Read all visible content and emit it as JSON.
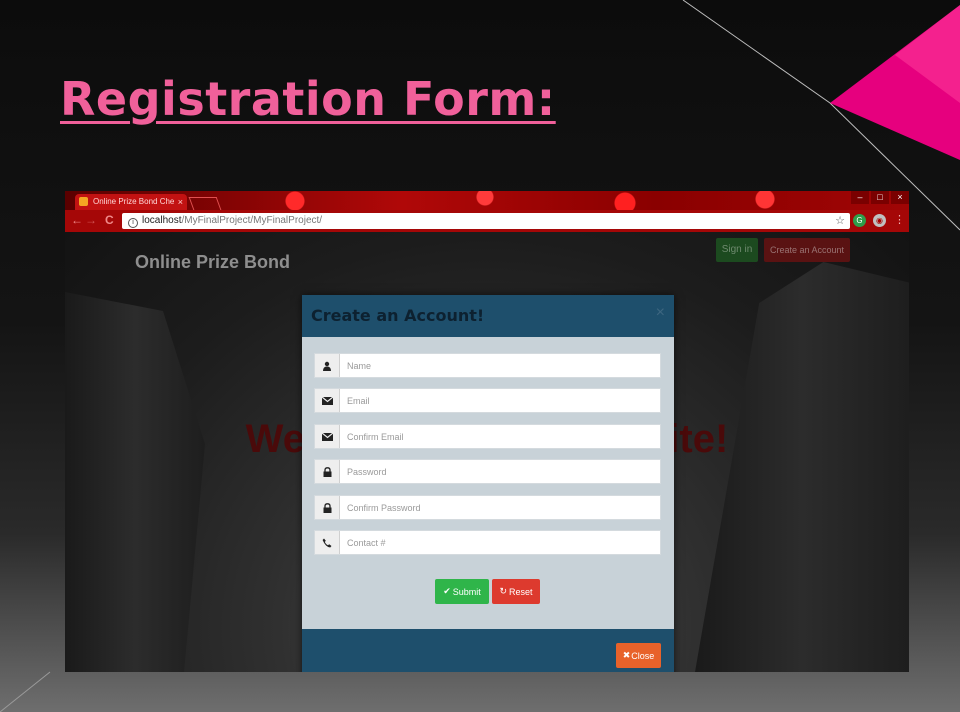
{
  "slide": {
    "title": "Registration Form:",
    "accent_color": "#f0609a"
  },
  "browser": {
    "tab_title": "Online Prize Bond Che",
    "tab_close": "×",
    "address_host": "localhost",
    "address_path": "/MyFinalProject/MyFinalProject/",
    "window_controls": [
      "–",
      "□",
      "×"
    ],
    "nav": {
      "back": "←",
      "forward": "→",
      "reload": "C"
    }
  },
  "site": {
    "brand": "Online Prize Bond",
    "welcome_left": "Wel",
    "welcome_right": "site!",
    "signin_label": "Sign in",
    "create_account_label": "Create an Account"
  },
  "modal": {
    "title": "Create an Account!",
    "close_x": "×",
    "fields": [
      {
        "icon": "user-icon",
        "placeholder": "Name"
      },
      {
        "icon": "envelope-icon",
        "placeholder": "Email"
      },
      {
        "icon": "envelope-icon",
        "placeholder": "Confirm Email"
      },
      {
        "icon": "lock-icon",
        "placeholder": "Password"
      },
      {
        "icon": "lock-icon",
        "placeholder": "Confirm Password"
      },
      {
        "icon": "phone-icon",
        "placeholder": "Contact #"
      }
    ],
    "submit_label": "Submit",
    "reset_label": "Reset",
    "close_label": "Close",
    "colors": {
      "header": "#1e4f6c",
      "submit": "#2fb54a",
      "reset": "#dd3a2e",
      "close": "#e8622a"
    }
  }
}
